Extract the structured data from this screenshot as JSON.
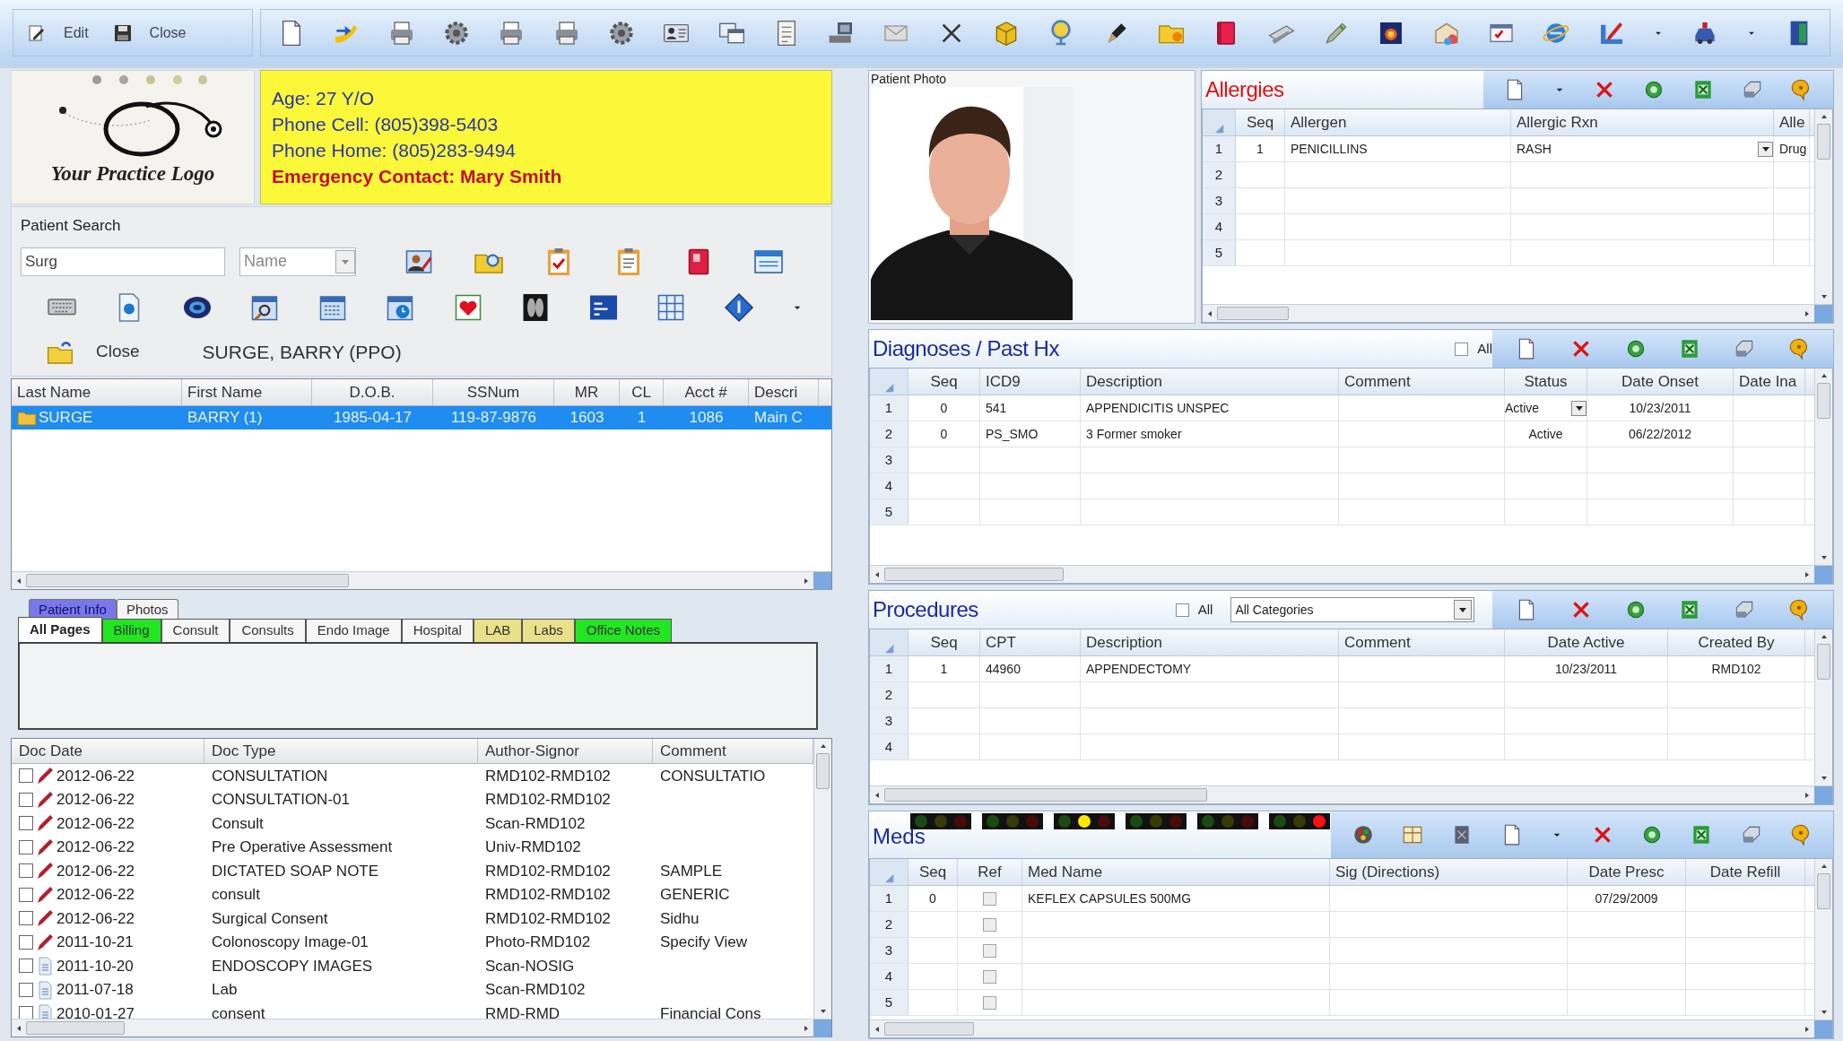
{
  "toolbar": {
    "buttons": [
      {
        "label": "Edit"
      },
      {
        "label": "Close"
      }
    ]
  },
  "logo": {
    "text": "Your Practice Logo"
  },
  "patient_header": {
    "lines": [
      {
        "kind": "info",
        "text": "Age: 27 Y/O"
      },
      {
        "kind": "info",
        "text": "Phone Cell: (805)398-5403"
      },
      {
        "kind": "info",
        "text": "Phone Home: (805)283-9494"
      },
      {
        "kind": "emergency",
        "text": "Emergency Contact: Mary Smith"
      }
    ]
  },
  "patient_search": {
    "label": "Patient Search",
    "search_field": {
      "value": "Surg"
    },
    "search_by": {
      "value": "Name"
    },
    "close_button": "Close",
    "patient_name": "SURGE, BARRY (PPO)"
  },
  "patient_list": {
    "columns": [
      "Last Name",
      "First Name",
      "D.O.B.",
      "SSNum",
      "MR",
      "CL",
      "Acct #",
      "Descri"
    ],
    "rows": [
      {
        "selected": true,
        "cells": [
          "SURGE",
          "BARRY (1)",
          "1985-04-17",
          "119-87-9876",
          "1603",
          "1",
          "1086",
          "Main C"
        ]
      }
    ]
  },
  "record_tabs": {
    "top": [
      {
        "label": "Patient Info",
        "selected": true
      },
      {
        "label": "Photos",
        "selected": false
      }
    ],
    "pages": [
      {
        "label": "All Pages",
        "selected": true,
        "color": "#ffffff"
      },
      {
        "label": "Billing",
        "selected": false,
        "color": "#22e622"
      },
      {
        "label": "Consult",
        "selected": false,
        "color": "#f6f6f6"
      },
      {
        "label": "Consults",
        "selected": false,
        "color": "#f6f6f6"
      },
      {
        "label": "Endo Image",
        "selected": false,
        "color": "#f6f6f6"
      },
      {
        "label": "Hospital",
        "selected": false,
        "color": "#f6f6f6"
      },
      {
        "label": "LAB",
        "selected": false,
        "color": "#e8e08a"
      },
      {
        "label": "Labs",
        "selected": false,
        "color": "#e8e08a"
      },
      {
        "label": "Office Notes",
        "selected": false,
        "color": "#22e622"
      }
    ]
  },
  "documents": {
    "columns": [
      "Doc Date",
      "Doc Type",
      "Author-Signor",
      "Comment"
    ],
    "rows": [
      {
        "kind": "pen",
        "checked": false,
        "date": "2012-06-22",
        "type": "CONSULTATION",
        "author": "RMD102-RMD102",
        "comment": "CONSULTATIO"
      },
      {
        "kind": "pen",
        "checked": false,
        "date": "2012-06-22",
        "type": "CONSULTATION-01",
        "author": "RMD102-RMD102"
      },
      {
        "kind": "pen",
        "checked": false,
        "date": "2012-06-22",
        "type": "Consult",
        "author": "Scan-RMD102"
      },
      {
        "kind": "pen",
        "checked": false,
        "date": "2012-06-22",
        "type": "Pre Operative Assessment",
        "author": "Univ-RMD102"
      },
      {
        "kind": "pen",
        "checked": false,
        "date": "2012-06-22",
        "type": "DICTATED SOAP NOTE",
        "author": "RMD102-RMD102",
        "comment": "SAMPLE"
      },
      {
        "kind": "pen",
        "checked": false,
        "date": "2012-06-22",
        "type": "consult",
        "author": "RMD102-RMD102",
        "comment": "GENERIC"
      },
      {
        "kind": "pen",
        "checked": false,
        "date": "2012-06-22",
        "type": "Surgical Consent",
        "author": "RMD102-RMD102",
        "comment": "Sidhu"
      },
      {
        "kind": "pen",
        "checked": false,
        "date": "2011-10-21",
        "type": "Colonoscopy Image-01",
        "author": "Photo-RMD102",
        "comment": "Specify View"
      },
      {
        "kind": "page",
        "checked": false,
        "date": "2011-10-20",
        "type": "ENDOSCOPY IMAGES",
        "author": "Scan-NOSIG"
      },
      {
        "kind": "page",
        "checked": false,
        "date": "2011-07-18",
        "type": "Lab",
        "author": "Scan-RMD102"
      },
      {
        "kind": "page",
        "checked": false,
        "date": "2010-01-27",
        "type": "consent",
        "author": "RMD-RMD",
        "comment": "Financial Cons"
      }
    ]
  },
  "patient_photo": {
    "label": "Patient Photo",
    "kind": "picture"
  },
  "allergies": {
    "title": "Allergies",
    "columns": [
      "Seq",
      "Allergen",
      "Allergic Rxn",
      "Alle"
    ],
    "rows": [
      {
        "number": "1",
        "cells": [
          "1",
          "PENICILLINS",
          {
            "kind": "dropdown",
            "text": "RASH"
          },
          "Drug"
        ]
      },
      {
        "number": "2",
        "cells": [
          null,
          null,
          null,
          null
        ]
      },
      {
        "number": "3",
        "cells": [
          null,
          null,
          null,
          null
        ]
      },
      {
        "number": "4",
        "cells": [
          null,
          null,
          null,
          null
        ]
      },
      {
        "number": "5",
        "cells": [
          null,
          null,
          null,
          null
        ]
      }
    ]
  },
  "diagnoses": {
    "title": "Diagnoses / Past Hx",
    "all_checkbox": {
      "label": "All",
      "checked": false
    },
    "columns": [
      "Seq",
      "ICD9",
      "Description",
      "Comment",
      "Status",
      "Date Onset",
      "Date Ina"
    ],
    "rows": [
      {
        "number": "1",
        "cells": [
          "0",
          "541",
          "APPENDICITIS UNSPEC",
          null,
          {
            "kind": "dropdown",
            "text": "Active"
          },
          "10/23/2011",
          null
        ]
      },
      {
        "number": "2",
        "cells": [
          "0",
          "PS_SMO",
          "3 Former smoker",
          null,
          "Active",
          "06/22/2012",
          null
        ]
      },
      {
        "number": "3",
        "cells": [
          null,
          null,
          null,
          null,
          null,
          null,
          null
        ]
      },
      {
        "number": "4",
        "cells": [
          null,
          null,
          null,
          null,
          null,
          null,
          null
        ]
      },
      {
        "number": "5",
        "cells": [
          null,
          null,
          null,
          null,
          null,
          null,
          null
        ]
      }
    ]
  },
  "procedures": {
    "title": "Procedures",
    "all_checkbox": {
      "label": "All",
      "checked": false
    },
    "category": {
      "value": "All Categories"
    },
    "columns": [
      "Seq",
      "CPT",
      "Description",
      "Comment",
      "Date Active",
      "Created By"
    ],
    "rows": [
      {
        "number": "1",
        "cells": [
          "1",
          "44960",
          "APPENDECTOMY",
          null,
          "10/23/2011",
          "RMD102"
        ]
      },
      {
        "number": "2",
        "cells": [
          null,
          null,
          null,
          null,
          null,
          null
        ]
      },
      {
        "number": "3",
        "cells": [
          null,
          null,
          null,
          null,
          null,
          null
        ]
      },
      {
        "number": "4",
        "cells": [
          null,
          null,
          null,
          null,
          null,
          null
        ]
      }
    ]
  },
  "meds": {
    "title": "Meds",
    "alerts": [
      {
        "green": false,
        "yellow": false,
        "red": false
      },
      {
        "green": false,
        "yellow": false,
        "red": false
      },
      {
        "green": false,
        "yellow": true,
        "red": false
      },
      {
        "green": false,
        "yellow": false,
        "red": false
      },
      {
        "green": false,
        "yellow": false,
        "red": false
      },
      {
        "green": false,
        "yellow": false,
        "red": true
      }
    ],
    "columns": [
      "Seq",
      "Ref",
      "Med Name",
      "Sig (Directions)",
      "Date Presc",
      "Date Refill"
    ],
    "rows": [
      {
        "number": "1",
        "cells": [
          "0",
          {
            "kind": "checkbox",
            "checked": false
          },
          "KEFLEX CAPSULES 500MG",
          null,
          "07/29/2009",
          null
        ]
      },
      {
        "number": "2",
        "cells": [
          null,
          {
            "kind": "checkbox",
            "checked": false
          },
          null,
          null,
          null,
          null
        ]
      },
      {
        "number": "3",
        "cells": [
          null,
          {
            "kind": "checkbox",
            "checked": false
          },
          null,
          null,
          null,
          null
        ]
      },
      {
        "number": "4",
        "cells": [
          null,
          {
            "kind": "checkbox",
            "checked": false
          },
          null,
          null,
          null,
          null
        ]
      },
      {
        "number": "5",
        "cells": [
          null,
          {
            "kind": "checkbox",
            "checked": false
          },
          null,
          null,
          null,
          null
        ]
      }
    ]
  }
}
